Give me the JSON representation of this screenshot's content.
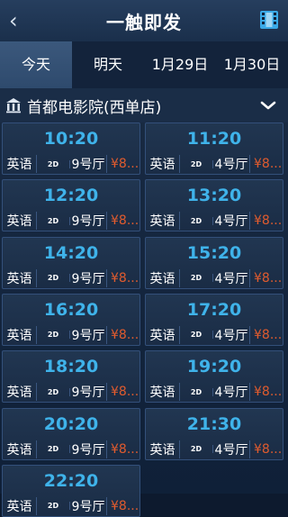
{
  "header": {
    "title": "一触即发",
    "back_icon": "‹"
  },
  "tabs": [
    "今天",
    "明天",
    "1月29日",
    "1月30日"
  ],
  "active_tab": 0,
  "cinema": {
    "name": "首都电影院(西单店)"
  },
  "showtimes": [
    {
      "time": "10:20",
      "lang": "英语",
      "format": "2D",
      "hall": "9号厅",
      "price": "¥8..."
    },
    {
      "time": "11:20",
      "lang": "英语",
      "format": "2D",
      "hall": "4号厅",
      "price": "¥8..."
    },
    {
      "time": "12:20",
      "lang": "英语",
      "format": "2D",
      "hall": "9号厅",
      "price": "¥8..."
    },
    {
      "time": "13:20",
      "lang": "英语",
      "format": "2D",
      "hall": "4号厅",
      "price": "¥8..."
    },
    {
      "time": "14:20",
      "lang": "英语",
      "format": "2D",
      "hall": "9号厅",
      "price": "¥8..."
    },
    {
      "time": "15:20",
      "lang": "英语",
      "format": "2D",
      "hall": "4号厅",
      "price": "¥8..."
    },
    {
      "time": "16:20",
      "lang": "英语",
      "format": "2D",
      "hall": "9号厅",
      "price": "¥8..."
    },
    {
      "time": "17:20",
      "lang": "英语",
      "format": "2D",
      "hall": "4号厅",
      "price": "¥8..."
    },
    {
      "time": "18:20",
      "lang": "英语",
      "format": "2D",
      "hall": "9号厅",
      "price": "¥8..."
    },
    {
      "time": "19:20",
      "lang": "英语",
      "format": "2D",
      "hall": "4号厅",
      "price": "¥8..."
    },
    {
      "time": "20:20",
      "lang": "英语",
      "format": "2D",
      "hall": "9号厅",
      "price": "¥8..."
    },
    {
      "time": "21:30",
      "lang": "英语",
      "format": "2D",
      "hall": "4号厅",
      "price": "¥8..."
    },
    {
      "time": "22:20",
      "lang": "英语",
      "format": "2D",
      "hall": "9号厅",
      "price": "¥8..."
    }
  ],
  "colors": {
    "time": "#3fb3ea",
    "price": "#e05b2e",
    "active_tab": "#3b587c"
  }
}
